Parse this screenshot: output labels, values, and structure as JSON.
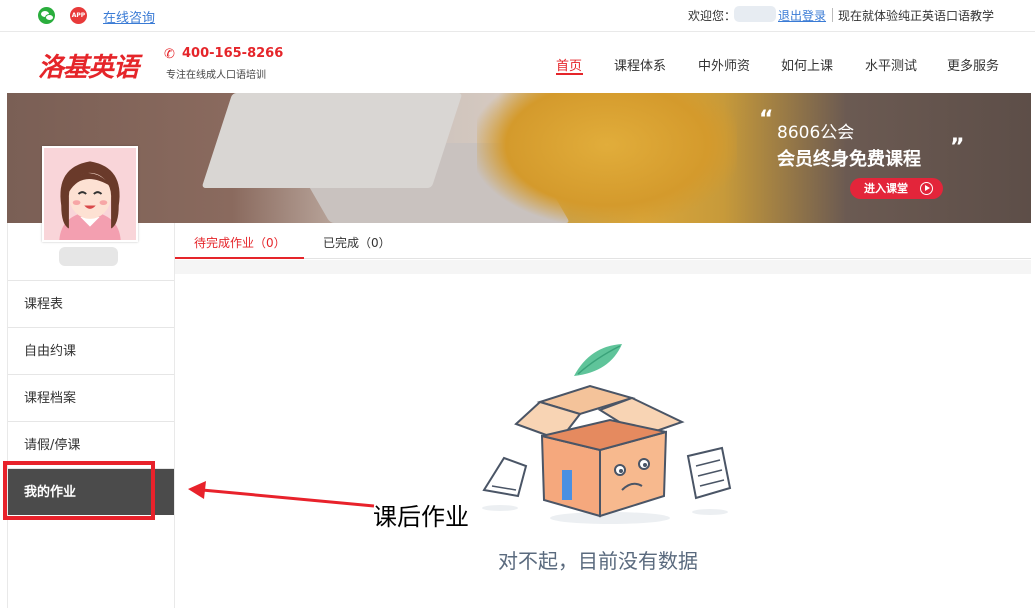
{
  "topbar": {
    "consult_label": "在线咨询",
    "app_icon_text": "APP",
    "welcome_label": "欢迎您：",
    "logout_label": "退出登录",
    "promo_label": "现在就体验纯正英语口语教学",
    "icons": [
      "wechat-icon",
      "app-icon"
    ]
  },
  "header": {
    "logo_text": "洛基英语",
    "phone": "400-165-8266",
    "slogan": "专注在线成人口语培训",
    "nav": [
      {
        "label": "首页",
        "active": true
      },
      {
        "label": "课程体系",
        "active": false
      },
      {
        "label": "中外师资",
        "active": false
      },
      {
        "label": "如何上课",
        "active": false
      },
      {
        "label": "水平测试",
        "active": false
      },
      {
        "label": "更多服务",
        "active": false
      }
    ]
  },
  "banner": {
    "line1": "8606公会",
    "line2": "会员终身免费课程",
    "button_label": "进入课堂"
  },
  "sidebar": {
    "menu": [
      {
        "label": "课程表",
        "active": false
      },
      {
        "label": "自由约课",
        "active": false
      },
      {
        "label": "课程档案",
        "active": false
      },
      {
        "label": "请假/停课",
        "active": false
      },
      {
        "label": "我的作业",
        "active": true
      }
    ]
  },
  "tabs": [
    {
      "label": "待完成作业（0）",
      "active": true
    },
    {
      "label": "已完成（0）",
      "active": false
    }
  ],
  "content": {
    "empty_message": "对不起，目前没有数据"
  },
  "annotation": {
    "label": "课后作业"
  },
  "colors": {
    "brand_red": "#e5252a",
    "active_menu_bg": "#4b4b4b",
    "link_blue": "#3a7bd5"
  }
}
